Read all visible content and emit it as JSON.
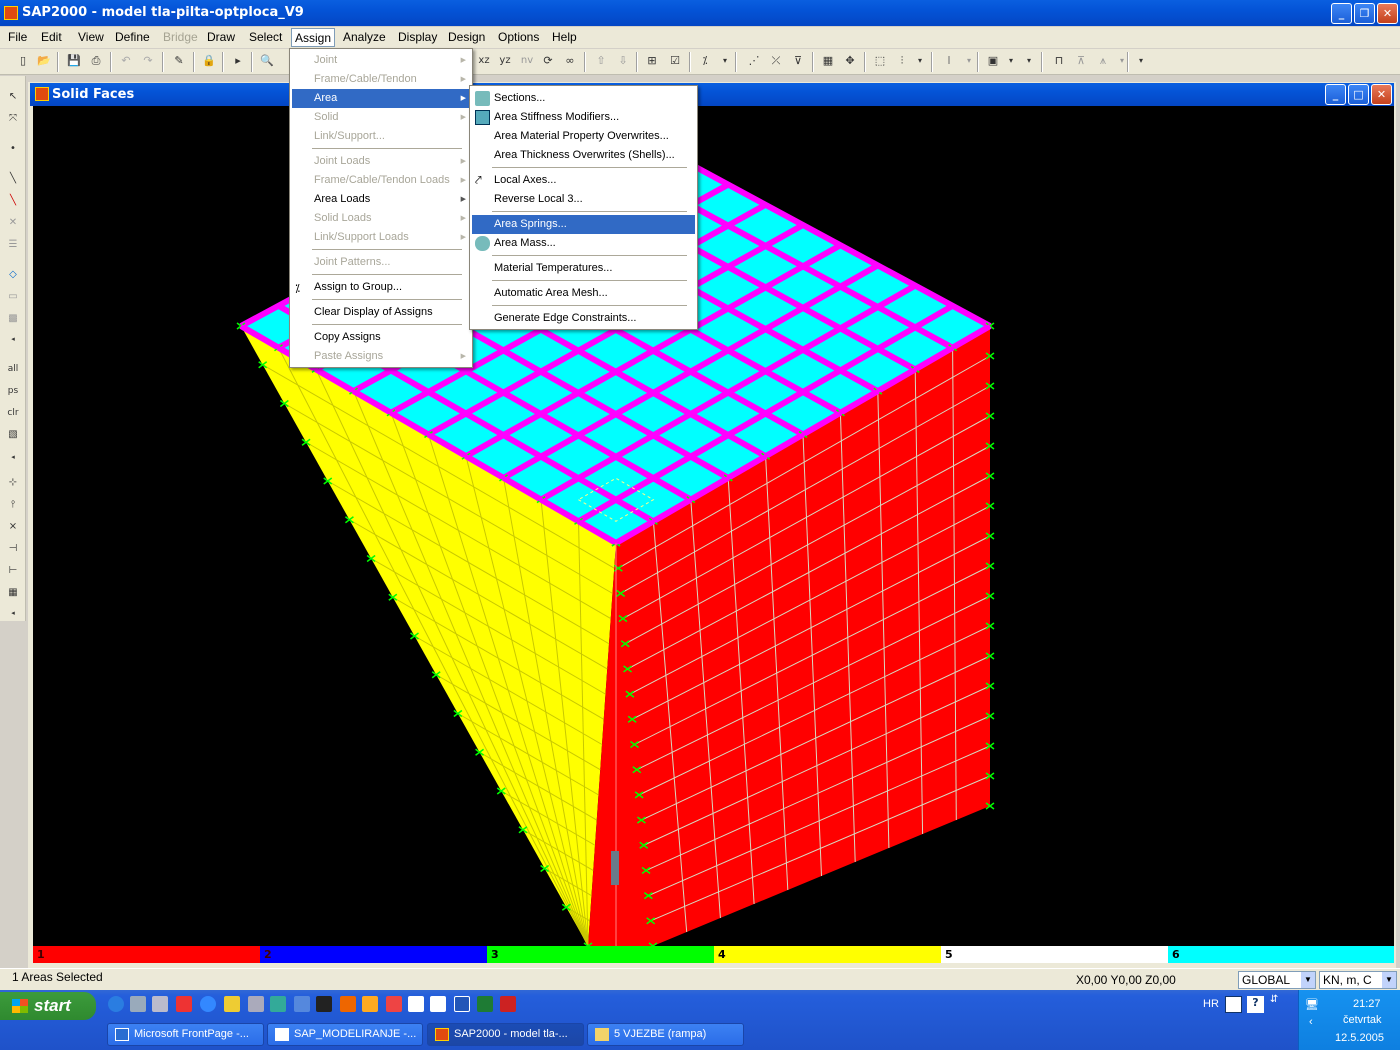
{
  "app": {
    "title": "SAP2000 - model tla-pilta-optploca_V9"
  },
  "menubar": [
    {
      "label": "File"
    },
    {
      "label": "Edit"
    },
    {
      "label": "View"
    },
    {
      "label": "Define"
    },
    {
      "label": "Bridge"
    },
    {
      "label": "Draw"
    },
    {
      "label": "Select"
    },
    {
      "label": "Assign"
    },
    {
      "label": "Analyze"
    },
    {
      "label": "Display"
    },
    {
      "label": "Design"
    },
    {
      "label": "Options"
    },
    {
      "label": "Help"
    }
  ],
  "toolbar": {
    "xz_label": "xz",
    "yz_label": "yz",
    "nv_label": "nv"
  },
  "left_toolbar": {
    "all_label": "all",
    "ps_label": "ps",
    "clr_label": "clr"
  },
  "child_window": {
    "title": "Solid Faces"
  },
  "assign_menu": [
    {
      "label": "Joint"
    },
    {
      "label": "Frame/Cable/Tendon"
    },
    {
      "label": "Area"
    },
    {
      "label": "Solid"
    },
    {
      "label": "Link/Support..."
    },
    {
      "label": "Joint Loads"
    },
    {
      "label": "Frame/Cable/Tendon Loads"
    },
    {
      "label": "Area Loads"
    },
    {
      "label": "Solid Loads"
    },
    {
      "label": "Link/Support Loads"
    },
    {
      "label": "Joint Patterns..."
    },
    {
      "label": "Assign to Group..."
    },
    {
      "label": "Clear Display of Assigns"
    },
    {
      "label": "Copy Assigns"
    },
    {
      "label": "Paste Assigns"
    }
  ],
  "area_submenu": [
    {
      "label": "Sections..."
    },
    {
      "label": "Area Stiffness Modifiers..."
    },
    {
      "label": "Area Material Property Overwrites..."
    },
    {
      "label": "Area Thickness Overwrites (Shells)..."
    },
    {
      "label": "Local Axes..."
    },
    {
      "label": "Reverse Local 3..."
    },
    {
      "label": "Area Springs..."
    },
    {
      "label": "Area Mass..."
    },
    {
      "label": "Material Temperatures..."
    },
    {
      "label": "Automatic Area Mesh..."
    },
    {
      "label": "Generate Edge Constraints..."
    }
  ],
  "legend": [
    {
      "label": "1",
      "color": "#ff0000"
    },
    {
      "label": "2",
      "color": "#0000ff"
    },
    {
      "label": "3",
      "color": "#00ff00"
    },
    {
      "label": "4",
      "color": "#ffff00"
    },
    {
      "label": "5",
      "color": "#ffffff"
    },
    {
      "label": "6",
      "color": "#00ffff"
    }
  ],
  "status": {
    "selection": "1 Areas Selected",
    "coords": "X0,00  Y0,00  Z0,00",
    "coord_system": "GLOBAL",
    "units": "KN, m, C"
  },
  "taskbar": {
    "start_label": "start",
    "tasks": [
      {
        "label": "Microsoft FrontPage -..."
      },
      {
        "label": "SAP_MODELIRANJE -..."
      },
      {
        "label": "SAP2000 - model tla-..."
      },
      {
        "label": "5 VJEZBE (rampa)"
      }
    ],
    "lang": "HR",
    "time": "21:27",
    "day": "četvrtak",
    "date": "12.5.2005"
  },
  "colors": {
    "face_front": "#ffff00",
    "face_right": "#ff0000",
    "face_top": "#00ffff",
    "frame_edges": "#ff00ff",
    "springs": "#00ff00",
    "menu_highlight": "#316ac5"
  }
}
